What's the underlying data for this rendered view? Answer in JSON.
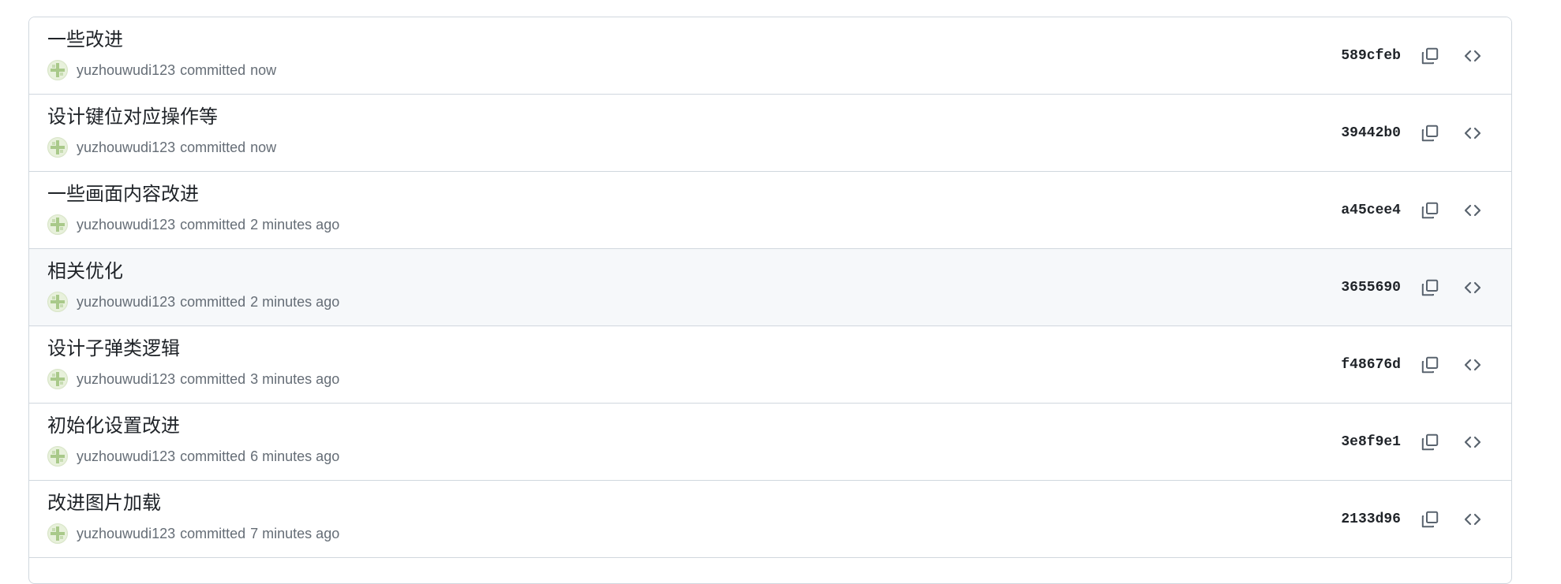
{
  "commits": [
    {
      "message": "一些改进",
      "author": "yuzhouwudi123",
      "verb": "committed",
      "time": "now",
      "sha": "589cfeb"
    },
    {
      "message": "设计键位对应操作等",
      "author": "yuzhouwudi123",
      "verb": "committed",
      "time": "now",
      "sha": "39442b0"
    },
    {
      "message": "一些画面内容改进",
      "author": "yuzhouwudi123",
      "verb": "committed",
      "time": "2 minutes ago",
      "sha": "a45cee4"
    },
    {
      "message": "相关优化",
      "author": "yuzhouwudi123",
      "verb": "committed",
      "time": "2 minutes ago",
      "sha": "3655690",
      "hovered": true
    },
    {
      "message": "设计子弹类逻辑",
      "author": "yuzhouwudi123",
      "verb": "committed",
      "time": "3 minutes ago",
      "sha": "f48676d"
    },
    {
      "message": "初始化设置改进",
      "author": "yuzhouwudi123",
      "verb": "committed",
      "time": "6 minutes ago",
      "sha": "3e8f9e1"
    },
    {
      "message": "改进图片加载",
      "author": "yuzhouwudi123",
      "verb": "committed",
      "time": "7 minutes ago",
      "sha": "2133d96"
    }
  ],
  "icons": {
    "copy": "copy-icon",
    "browse": "code-icon",
    "avatar": "avatar-icon"
  },
  "colors": {
    "border": "#d0d7de",
    "hover_bg": "#f6f8fa",
    "muted_text": "#656d76",
    "text": "#1f2328"
  }
}
